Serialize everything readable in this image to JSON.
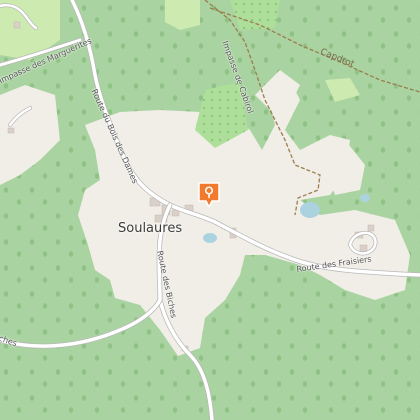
{
  "map": {
    "place_label": "Soulaures",
    "road_labels": {
      "bois_des_dames": "Route du Bois des Dames",
      "marguerites": "Impasse des Marguerites",
      "biches": "Route des Biches",
      "fraisiers": "Route des Fraisiers",
      "cabirol": "Impasse de Cabirol",
      "biches_partial": "iches"
    },
    "track_label": "Capdrot",
    "marker": {
      "icon": "location-pin-icon",
      "color": "#f07a2e"
    },
    "colors": {
      "forest": "#a9d3a0",
      "cleared": "#f1eee8",
      "meadow": "#cdebb0",
      "orchard": "#aedf9a",
      "water": "#aad3df",
      "building": "#d9d0c9",
      "road": "#ffffff",
      "road_casing": "#b8b8b8",
      "track": "#9c7d4f",
      "tree": "#8fc285"
    }
  }
}
